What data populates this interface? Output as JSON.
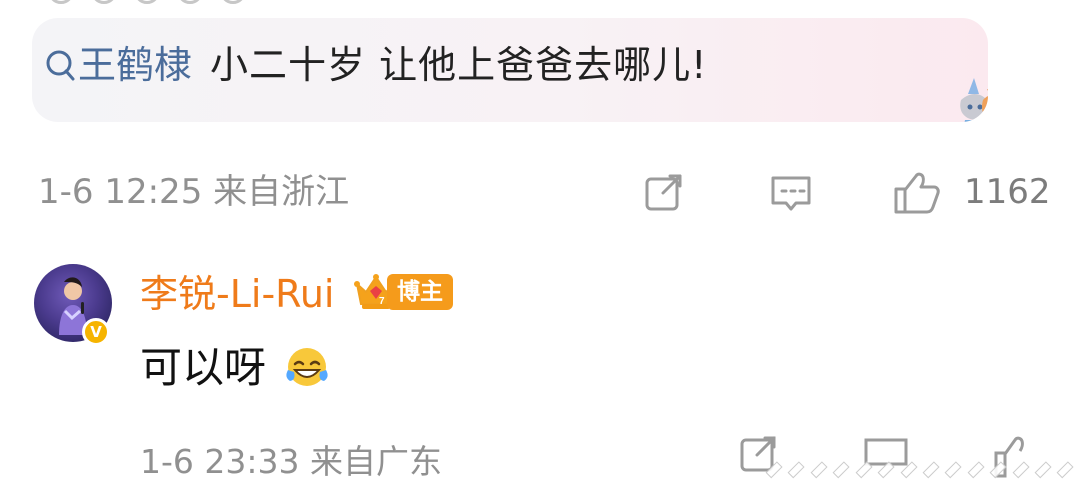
{
  "quote": {
    "username": "王鹤棣",
    "text": "小二十岁 让他上爸爸去哪儿!",
    "icons": {
      "search": "search-icon",
      "sticker": "zootopia-sticker"
    }
  },
  "main_comment_meta": {
    "time_source": "1-6 12:25 来自浙江",
    "like_count": "1162",
    "icons": {
      "share": "share-icon",
      "comment": "comment-icon",
      "like": "thumbs-up-icon"
    }
  },
  "reply": {
    "name": "李锐-Li-Rui",
    "badge_label": "博主",
    "text": "可以呀",
    "time_source": "1-6 23:33 来自广东",
    "icons": {
      "avatar": "avatar",
      "verified": "verified-badge",
      "crown": "crown-icon",
      "emoji": "laughing-tears-emoji",
      "share": "share-icon",
      "comment": "comment-icon",
      "like": "thumbs-up-icon"
    }
  },
  "colors": {
    "link_blue": "#4b6d9b",
    "orange_name": "#ef7b1a",
    "badge_orange": "#f59b1b",
    "meta_gray": "#909090"
  }
}
